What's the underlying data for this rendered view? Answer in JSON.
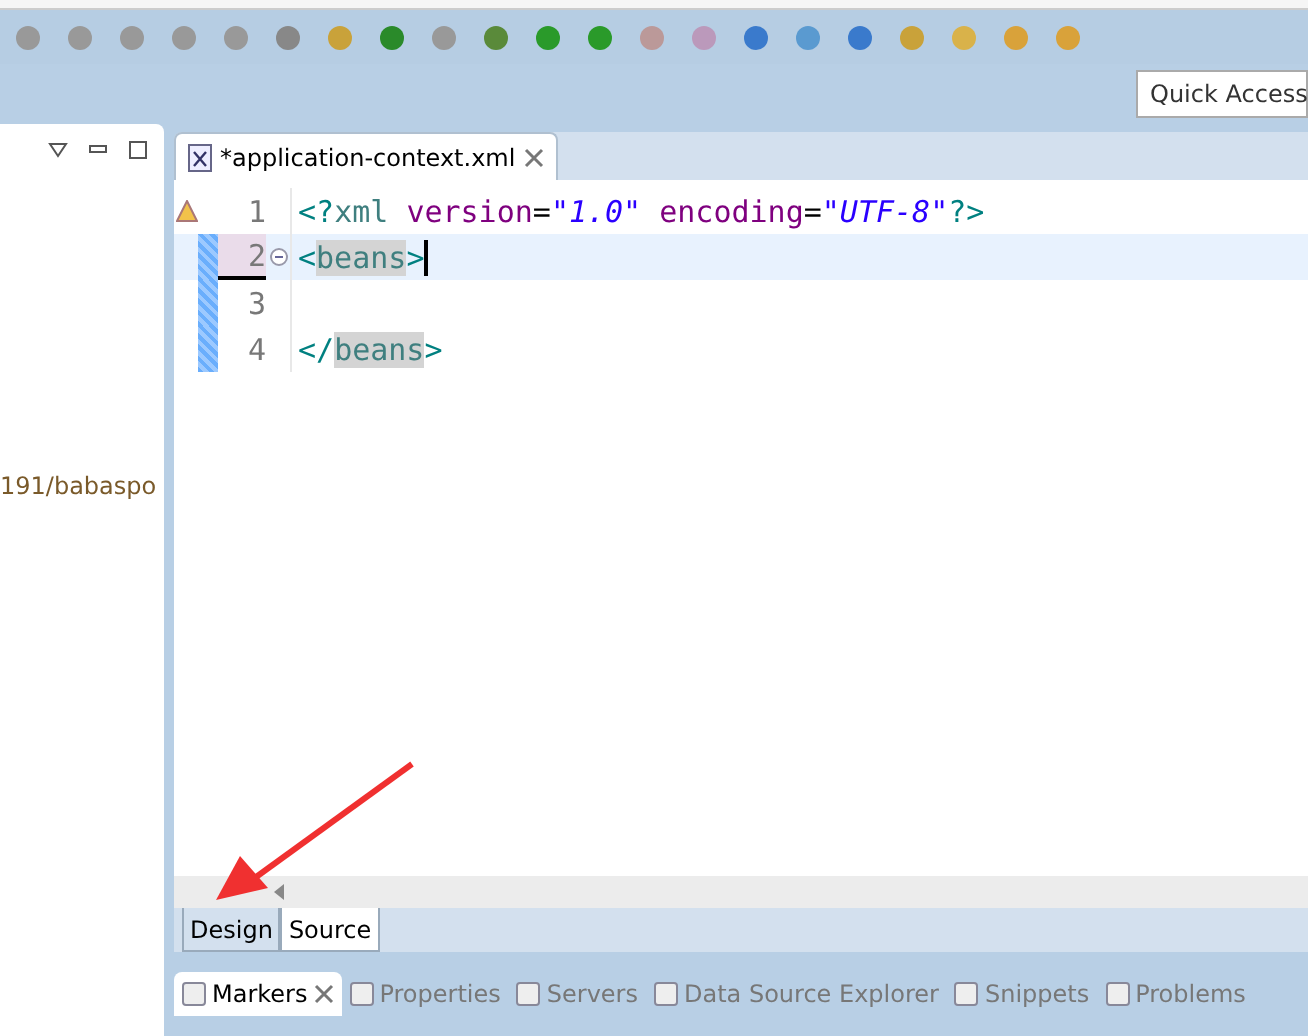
{
  "toolbar": {
    "quick_access": "Quick Access"
  },
  "left_panel": {
    "path_text": "191/babaspo"
  },
  "editor": {
    "tab": {
      "title": "*application-context.xml"
    },
    "lines": [
      {
        "number": "1",
        "warning": true,
        "current": false,
        "tokens": [
          {
            "kind": "bracket",
            "text": "<?"
          },
          {
            "kind": "tag",
            "text": "xml "
          },
          {
            "kind": "attr",
            "text": "version"
          },
          {
            "kind": "plain",
            "text": "="
          },
          {
            "kind": "value",
            "text": "\"1.0\""
          },
          {
            "kind": "attr",
            "text": " encoding"
          },
          {
            "kind": "plain",
            "text": "="
          },
          {
            "kind": "value",
            "text": "\"UTF-8\""
          },
          {
            "kind": "bracket",
            "text": "?>"
          }
        ]
      },
      {
        "number": "2",
        "warning": false,
        "current": true,
        "tokens": [
          {
            "kind": "bracket",
            "text": "<"
          },
          {
            "kind": "match",
            "text": "beans"
          },
          {
            "kind": "bracket",
            "text": ">"
          }
        ]
      },
      {
        "number": "3",
        "warning": false,
        "current": false
      },
      {
        "number": "4",
        "warning": false,
        "current": false,
        "tokens": [
          {
            "kind": "bracket",
            "text": "</"
          },
          {
            "kind": "match",
            "text": "beans"
          },
          {
            "kind": "bracket",
            "text": ">"
          }
        ]
      }
    ],
    "mode_tabs": [
      {
        "label": "Design",
        "selected": false
      },
      {
        "label": "Source",
        "selected": true
      }
    ]
  },
  "bottom_tabs": [
    {
      "label": "Markers",
      "selected": true
    },
    {
      "label": "Properties",
      "selected": false
    },
    {
      "label": "Servers",
      "selected": false
    },
    {
      "label": "Data Source Explorer",
      "selected": false
    },
    {
      "label": "Snippets",
      "selected": false
    },
    {
      "label": "Problems",
      "selected": false
    }
  ]
}
